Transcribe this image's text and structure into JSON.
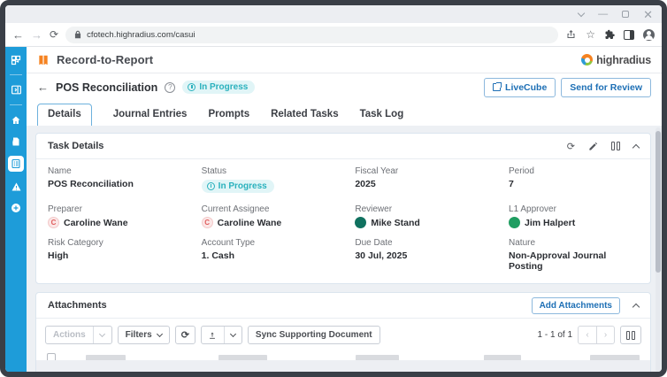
{
  "colors": {
    "sidebar_blue": "#1e9cd9",
    "brand_orange": "#f58220",
    "status_teal": "#2ab1bd",
    "button_blue": "#1d6fb5"
  },
  "window": {
    "controls": [
      "chevron-down",
      "minimize",
      "maximize",
      "close"
    ]
  },
  "browser": {
    "url": "cfotech.highradius.com/casui"
  },
  "sidebar": {
    "icons": [
      "apps-grid",
      "panel-toggle",
      "home",
      "document",
      "task-checklist-active",
      "warning-triangle",
      "plus-circle"
    ]
  },
  "app_header": {
    "title": "Record-to-Report",
    "logo_text": "highradius"
  },
  "page_header": {
    "title": "POS Reconciliation",
    "status": "In Progress",
    "buttons": [
      {
        "label": "LiveCube"
      },
      {
        "label": "Send for Review"
      }
    ]
  },
  "tabs": [
    {
      "label": "Details",
      "active": true
    },
    {
      "label": "Journal Entries",
      "active": false
    },
    {
      "label": "Prompts",
      "active": false
    },
    {
      "label": "Related Tasks",
      "active": false
    },
    {
      "label": "Task Log",
      "active": false
    }
  ],
  "task_details": {
    "title": "Task Details",
    "header_icons": [
      "refresh-icon",
      "edit-icon",
      "columns-icon",
      "collapse-icon"
    ],
    "fields": [
      {
        "label": "Name",
        "value": "POS Reconciliation",
        "type": "text"
      },
      {
        "label": "Status",
        "value": "In Progress",
        "type": "badge"
      },
      {
        "label": "Fiscal Year",
        "value": "2025",
        "type": "text"
      },
      {
        "label": "Period",
        "value": "7",
        "type": "text"
      },
      {
        "label": "Preparer",
        "value": "Caroline Wane",
        "type": "person",
        "avatar_initial": "C",
        "avatar_style": "light-red"
      },
      {
        "label": "Current Assignee",
        "value": "Caroline Wane",
        "type": "person",
        "avatar_initial": "C",
        "avatar_style": "light-red"
      },
      {
        "label": "Reviewer",
        "value": "Mike Stand",
        "type": "person",
        "avatar_initial": "",
        "avatar_style": "dark-green"
      },
      {
        "label": "L1 Approver",
        "value": "Jim Halpert",
        "type": "person",
        "avatar_initial": "",
        "avatar_style": "green"
      },
      {
        "label": "Risk Category",
        "value": "High",
        "type": "text"
      },
      {
        "label": "Account Type",
        "value": "1. Cash",
        "type": "text"
      },
      {
        "label": "Due Date",
        "value": "30 Jul, 2025",
        "type": "text"
      },
      {
        "label": "Nature",
        "value": "Non-Approval Journal Posting",
        "type": "text"
      }
    ]
  },
  "attachments": {
    "title": "Attachments",
    "add_button": "Add Attachments",
    "toolbar": {
      "actions_label": "Actions",
      "filters_label": "Filters",
      "sync_label": "Sync Supporting Document",
      "icon_buttons": [
        "refresh-icon",
        "upload-icon"
      ]
    },
    "pagination": "1 - 1 of 1"
  }
}
